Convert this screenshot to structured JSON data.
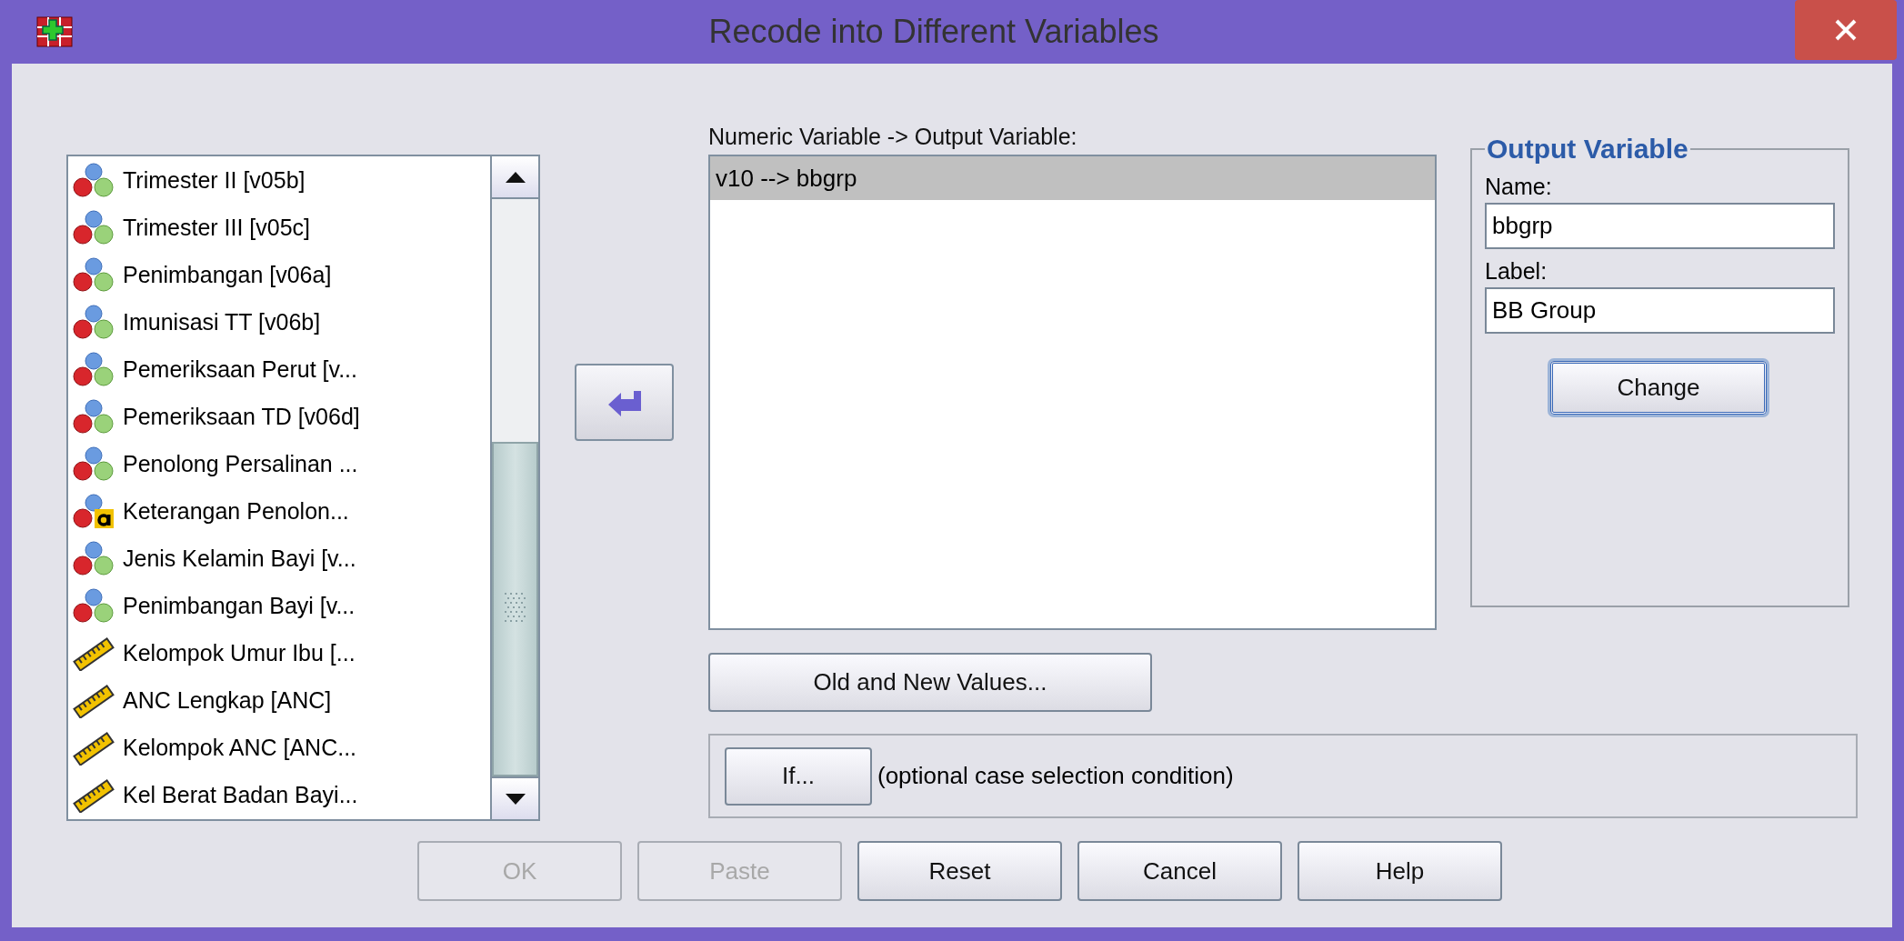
{
  "window": {
    "title": "Recode into Different Variables"
  },
  "variables": [
    {
      "name": "Trimester II [v05b]",
      "kind": "nominal"
    },
    {
      "name": "Trimester III [v05c]",
      "kind": "nominal"
    },
    {
      "name": "Penimbangan [v06a]",
      "kind": "nominal"
    },
    {
      "name": "Imunisasi TT [v06b]",
      "kind": "nominal"
    },
    {
      "name": "Pemeriksaan Perut [v...",
      "kind": "nominal"
    },
    {
      "name": "Pemeriksaan TD [v06d]",
      "kind": "nominal"
    },
    {
      "name": "Penolong Persalinan ...",
      "kind": "nominal"
    },
    {
      "name": "Keterangan Penolon...",
      "kind": "string"
    },
    {
      "name": "Jenis Kelamin Bayi [v...",
      "kind": "nominal"
    },
    {
      "name": "Penimbangan Bayi [v...",
      "kind": "nominal"
    },
    {
      "name": "Kelompok Umur Ibu [...",
      "kind": "scale"
    },
    {
      "name": "ANC Lengkap [ANC]",
      "kind": "scale"
    },
    {
      "name": "Kelompok ANC [ANC...",
      "kind": "scale"
    },
    {
      "name": "Kel Berat Badan Bayi...",
      "kind": "scale"
    }
  ],
  "mapping": {
    "heading": "Numeric Variable -> Output Variable:",
    "rows": [
      {
        "text": "v10 --> bbgrp",
        "selected": true
      }
    ]
  },
  "output_variable": {
    "title": "Output Variable",
    "name_label": "Name:",
    "name_value": "bbgrp",
    "label_label": "Label:",
    "label_value": "BB Group",
    "change_button": {
      "label": "Change",
      "focused": true
    }
  },
  "old_new_button": "Old and New Values...",
  "if_button": "If...",
  "if_note": "(optional case selection condition)",
  "buttons": [
    {
      "label": "OK",
      "disabled": true
    },
    {
      "label": "Paste",
      "disabled": true
    },
    {
      "label": "Reset",
      "disabled": false
    },
    {
      "label": "Cancel",
      "disabled": false
    },
    {
      "label": "Help",
      "disabled": false
    }
  ]
}
